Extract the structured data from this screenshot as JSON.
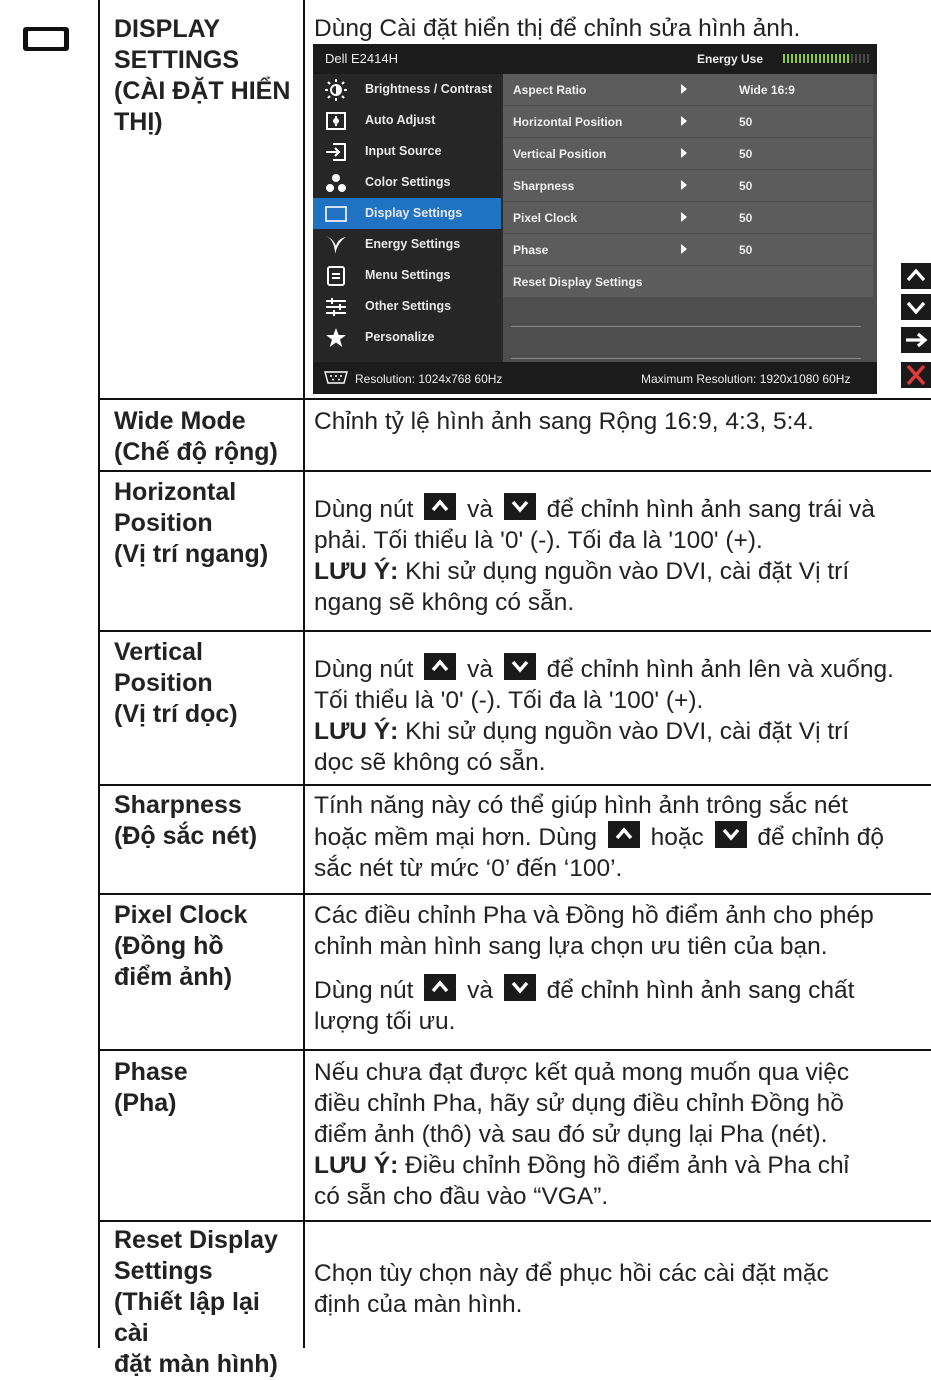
{
  "section": {
    "label": "DISPLAY SETTINGS (CÀI ĐẶT HIỂN THỊ)",
    "label_lines": [
      "DISPLAY",
      "SETTINGS",
      "(CÀI ĐẶT HIỂN",
      "THỊ)"
    ],
    "intro": "Dùng Cài đặt hiển thị để chỉnh sửa hình ảnh.",
    "icon": "monitor-icon"
  },
  "osd": {
    "model": "Dell E2414H",
    "energy_label": "Energy Use",
    "energy_level": 0.8,
    "menu": [
      {
        "label": "Brightness / Contrast",
        "icon": "brightness-icon"
      },
      {
        "label": "Auto Adjust",
        "icon": "auto-adjust-icon"
      },
      {
        "label": "Input Source",
        "icon": "input-source-icon"
      },
      {
        "label": "Color Settings",
        "icon": "color-settings-icon"
      },
      {
        "label": "Display Settings",
        "icon": "display-settings-icon",
        "active": true
      },
      {
        "label": "Energy Settings",
        "icon": "energy-settings-icon"
      },
      {
        "label": "Menu Settings",
        "icon": "menu-settings-icon"
      },
      {
        "label": "Other Settings",
        "icon": "other-settings-icon"
      },
      {
        "label": "Personalize",
        "icon": "star-icon"
      }
    ],
    "submenu": [
      {
        "label": "Aspect Ratio",
        "value": "Wide 16:9"
      },
      {
        "label": "Horizontal Position",
        "value": "50"
      },
      {
        "label": "Vertical Position",
        "value": "50"
      },
      {
        "label": "Sharpness",
        "value": "50"
      },
      {
        "label": "Pixel Clock",
        "value": "50"
      },
      {
        "label": "Phase",
        "value": "50"
      },
      {
        "label": "Reset Display Settings",
        "value": ""
      }
    ],
    "resolution": "Resolution:  1024x768 60Hz",
    "max_resolution": "Maximum Resolution: 1920x1080 60Hz"
  },
  "side_buttons": [
    "up-icon",
    "down-icon",
    "enter-arrow-icon",
    "close-x-icon"
  ],
  "rows": [
    {
      "label_lines": [
        "Wide Mode",
        "(Chế độ rộng)"
      ],
      "desc": "Chỉnh tỷ lệ hình ảnh sang Rộng 16:9, 4:3, 5:4."
    },
    {
      "label_lines": [
        "Horizontal",
        "Position",
        "(Vị trí ngang)"
      ],
      "desc_pre": "Dùng nút",
      "desc_mid": "và",
      "desc_post": "để chỉnh hình ảnh sang trái và",
      "desc_line2": "phải. Tối thiểu là '0' (-). Tối đa là '100' (+).",
      "note_label": "LƯU Ý:",
      "note_text": " Khi sử dụng nguồn vào DVI, cài đặt Vị trí",
      "note_line2": "ngang sẽ không có sẵn."
    },
    {
      "label_lines": [
        "Vertical",
        "Position",
        "(Vị trí dọc)"
      ],
      "desc_pre": "Dùng nút",
      "desc_mid": "và",
      "desc_post": "để chỉnh hình ảnh lên và xuống.",
      "desc_line2": "Tối thiểu là '0' (-). Tối đa là '100' (+).",
      "note_label": "LƯU Ý:",
      "note_text": " Khi sử dụng nguồn vào DVI, cài đặt Vị trí",
      "note_line2": "dọc sẽ không có sẵn."
    },
    {
      "label_lines": [
        "Sharpness",
        "(Độ sắc nét)"
      ],
      "desc_line1": "Tính năng này có thể giúp hình ảnh trông sắc nét",
      "desc_pre": "hoặc mềm mại hơn. Dùng",
      "desc_mid": "hoặc",
      "desc_post": "để chỉnh độ",
      "desc_line3": "sắc nét từ mức ‘0’ đến ‘100’."
    },
    {
      "label_lines": [
        "Pixel Clock",
        "(Đồng hồ",
        "điểm ảnh)"
      ],
      "desc_line1": "Các điều chỉnh Pha và Đồng hồ điểm ảnh cho phép",
      "desc_line2": "chỉnh màn hình sang lựa chọn ưu tiên của bạn.",
      "desc_pre": "Dùng nút",
      "desc_mid": "và",
      "desc_post": "để chỉnh hình ảnh sang chất",
      "desc_line4": "lượng tối ưu."
    },
    {
      "label_lines": [
        "Phase",
        "(Pha)"
      ],
      "desc_line1": "Nếu chưa đạt được kết quả mong muốn qua việc",
      "desc_line2": "điều chỉnh Pha, hãy sử dụng điều chỉnh Đồng hồ",
      "desc_line3": "điểm ảnh (thô) và sau đó sử dụng lại Pha (nét).",
      "note_label": "LƯU Ý:",
      "note_text": " Điều chỉnh Đồng hồ điểm ảnh và Pha chỉ",
      "note_line2": "có sẵn cho đầu vào “VGA”."
    },
    {
      "label_lines": [
        "Reset Display",
        "Settings",
        "(Thiết lập lại cài",
        "đặt màn hình)"
      ],
      "desc_line1": "Chọn tùy chọn này để phục hồi các cài đặt mặc",
      "desc_line2": "định của màn hình."
    }
  ]
}
